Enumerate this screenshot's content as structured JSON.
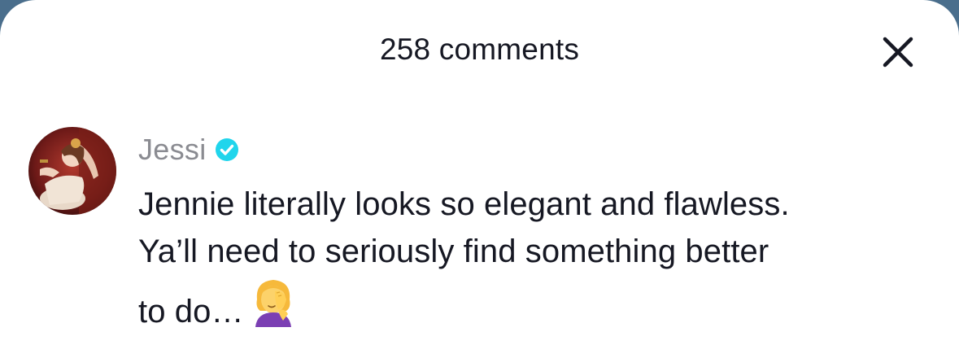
{
  "header": {
    "title": "258 comments",
    "close_icon": "close-icon"
  },
  "comment": {
    "author": "Jessi",
    "verified_badge": "verified-check-icon",
    "avatar": "avatar-photo",
    "text_lines": [
      "Jennie literally looks so elegant and flawless.",
      "Ya’ll need to seriously find something better",
      "to do…"
    ],
    "emoji": "woman-facepalming-emoji"
  },
  "colors": {
    "text_primary": "#161823",
    "text_secondary": "#8a8b91",
    "verified_blue": "#20d5ec",
    "backdrop": "#4a6e8c"
  }
}
